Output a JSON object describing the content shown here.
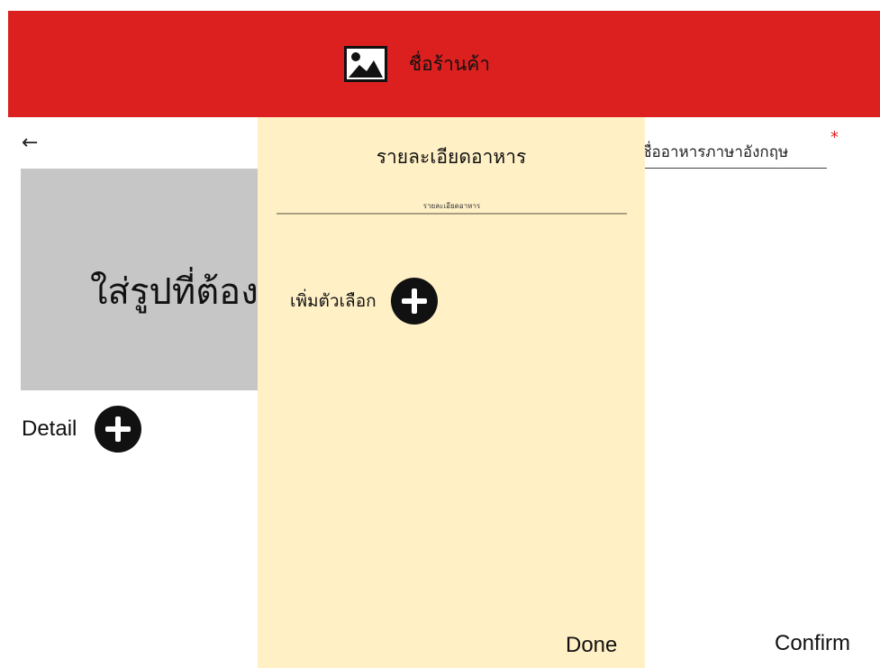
{
  "header": {
    "store_name": "ชื่อร้านค้า",
    "background_color": "#dc1f1f",
    "logo_icon": "image-icon"
  },
  "navigation": {
    "back_icon": "arrow-left-icon",
    "back_glyph": "←"
  },
  "product_form": {
    "image_placeholder_text": "ใส่รูปที่ต้องการ",
    "detail_label": "Detail",
    "detail_add_icon": "plus-circle-icon",
    "english_name_text": "ชื่ออาหารภาษาอังกฤษ",
    "required_mark": "*",
    "confirm_label": "Confirm"
  },
  "detail_modal": {
    "title": "รายละเอียดอาหาร",
    "input_text": "รายละเอียดอาหาร",
    "add_option_label": "เพิ่มตัวเลือก",
    "add_option_icon": "plus-circle-icon",
    "done_label": "Done",
    "background_color": "#fff0c6"
  }
}
